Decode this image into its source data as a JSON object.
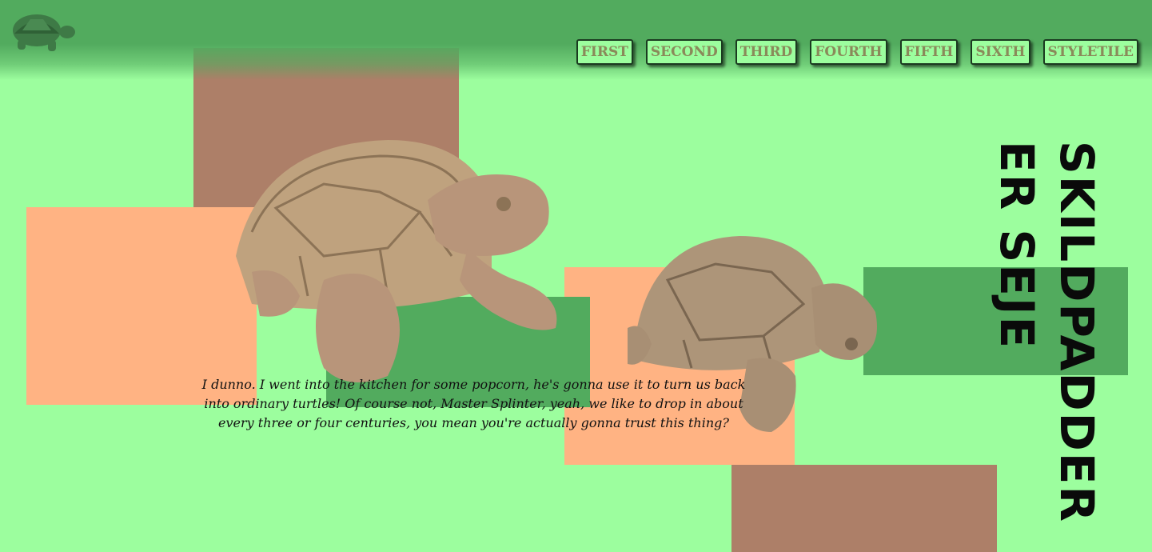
{
  "header": {
    "logo_icon": "turtle-logo-icon",
    "nav": [
      "FIRST",
      "SECOND",
      "THIRD",
      "FOURTH",
      "FIFTH",
      "SIXTH",
      "STYLETILE"
    ]
  },
  "hero": {
    "title_line1": "SKILDPADDER",
    "title_line2": "ER SEJE",
    "caption": "I dunno. I went into the kitchen for some popcorn, he's gonna use it to turn us back into ordinary turtles! Of course not, Master Splinter, yeah, we like to drop in about every three or four centuries, you mean you're actually gonna trust this thing?"
  },
  "colors": {
    "background": "#9cfe9e",
    "header": "#52ab5e",
    "brown": "#ad7f68",
    "peach": "#ffb383",
    "green": "#52ab5e",
    "nav_text": "#8a8a5a"
  }
}
